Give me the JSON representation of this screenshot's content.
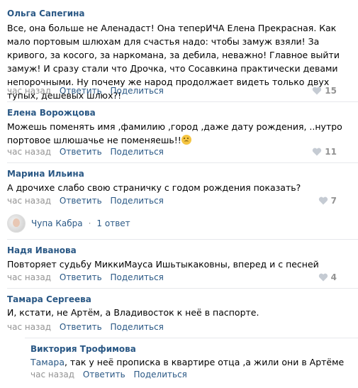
{
  "comments": [
    {
      "author": "Ольга Сапегина",
      "text": "Все, она больше не Аленадаст! Она теперИЧА Елена Прекрасная. Как мало портовым шлюхам для счастья надо: чтобы замуж взяли! За кривого, за косого, за наркомана, за дебила, неважно! Главное выйти замуж! И сразу стали что Дрочка, что Сосавкина практически девами непорочными. Ну почему же народ продолжает видеть только двух тупых, дешевых шлюх?!",
      "time": "час назад",
      "reply": "Ответить",
      "share": "Поделиться",
      "likes": "15"
    },
    {
      "author": "Елена Ворожцова",
      "text": "Можешь поменять имя ,фамилию ,город ,даже дату рождения, ..нутро портовое шлюшачье не поменяешь!!",
      "time": "час назад",
      "reply": "Ответить",
      "share": "Поделиться",
      "likes": "11"
    },
    {
      "author": "Марина Ильина",
      "text": "А дрочихе слабо свою страничку с годом рождения показать?",
      "time": "час назад",
      "reply": "Ответить",
      "share": "Поделиться",
      "likes": "7"
    },
    {
      "author": "Надя Иванова",
      "text": "Повторяет судьбу МиккиМауса Ишьтыкаковны, вперед и с песней",
      "time": "час назад",
      "reply": "Ответить",
      "share": "Поделиться",
      "likes": "4"
    },
    {
      "author": "Тамара Сергеева",
      "text": "И, кстати, не Артём, а Владивосток к неё в паспорте.",
      "time": "час назад",
      "reply": "Ответить",
      "share": "Поделиться"
    }
  ],
  "thread": {
    "name": "Чупа Кабра",
    "dot": "·",
    "count": "1 ответ"
  },
  "reply": {
    "author": "Виктория Трофимова",
    "to": "Тамара",
    "text": ", так у неё прописка в квартире отца ,а жили они в Артёме",
    "time": "час назад",
    "reply": "Ответить",
    "share": "Поделиться"
  },
  "icons": {
    "like": "heart-icon",
    "emoji": "sad-face-emoji"
  },
  "colors": {
    "link": "#2a5885",
    "muted": "#939393",
    "separator": "#e7e8ec"
  }
}
